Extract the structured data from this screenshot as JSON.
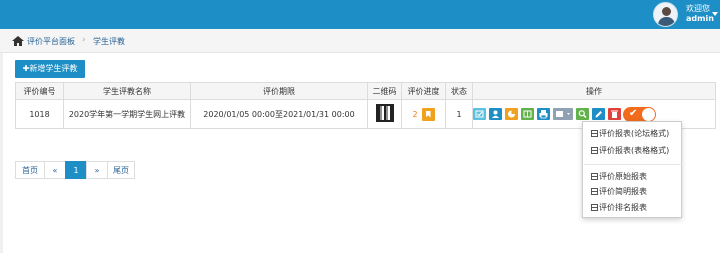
{
  "header": {
    "welcome": "欢迎您",
    "username": "admin"
  },
  "breadcrumb": {
    "home": "评价平台面板",
    "separator": "›",
    "current": "学生评教"
  },
  "toolbar": {
    "add_label": "✚新增学生评教"
  },
  "table": {
    "columns": [
      "评价编号",
      "学生评教名称",
      "评价期限",
      "二维码",
      "评价进度",
      "状态",
      "操作"
    ],
    "rows": [
      {
        "id": "1018",
        "name": "2020学年第一学期学生网上评教",
        "period": "2020/01/05 00:00至2021/01/31 00:00",
        "progress": "2",
        "status": "1"
      }
    ]
  },
  "operation_icons": [
    "checkbox-icon",
    "user-icon",
    "pie-chart-icon",
    "book-icon",
    "print-icon",
    "calendar-icon",
    "search-icon",
    "edit-icon",
    "delete-icon"
  ],
  "toggle_state": "on",
  "dropdown": {
    "items": [
      "评价报表(论坛格式)",
      "评价报表(表格格式)",
      "评价原始报表",
      "评价简明报表",
      "评价排名报表"
    ]
  },
  "pagination": {
    "first": "首页",
    "prev": "«",
    "current": "1",
    "next": "»",
    "last": "尾页"
  },
  "colors": {
    "primary": "#1e8fc6",
    "warning": "#f0a21e",
    "danger": "#e0413c",
    "toggle": "#f26b1d"
  }
}
